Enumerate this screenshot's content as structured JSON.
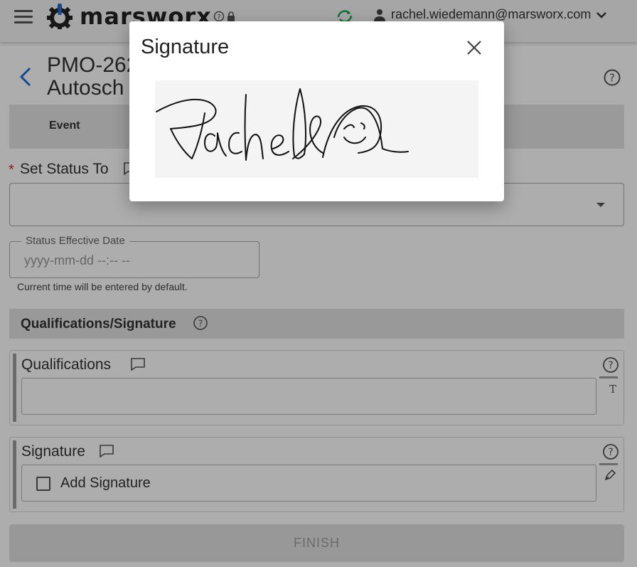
{
  "header": {
    "brand": "marsworx",
    "user_email": "rachel.wiedemann@marsworx.com",
    "accent": "#1aa34a"
  },
  "document": {
    "title_line1": "PMO-262",
    "title_line2": "Autosch"
  },
  "tabs": [
    {
      "label": "Event"
    }
  ],
  "status": {
    "label": "Set Status To",
    "required_mark": "*"
  },
  "effective_date": {
    "legend": "Status Effective Date",
    "placeholder": "yyyy-mm-dd --:-- --",
    "hint": "Current time will be entered by default."
  },
  "section": {
    "title": "Qualifications/Signature"
  },
  "qualifications": {
    "label": "Qualifications",
    "tool_label": "T"
  },
  "signature_field": {
    "label": "Signature",
    "add_label": "Add Signature"
  },
  "finish_label": "FINISH",
  "modal": {
    "title": "Signature"
  }
}
